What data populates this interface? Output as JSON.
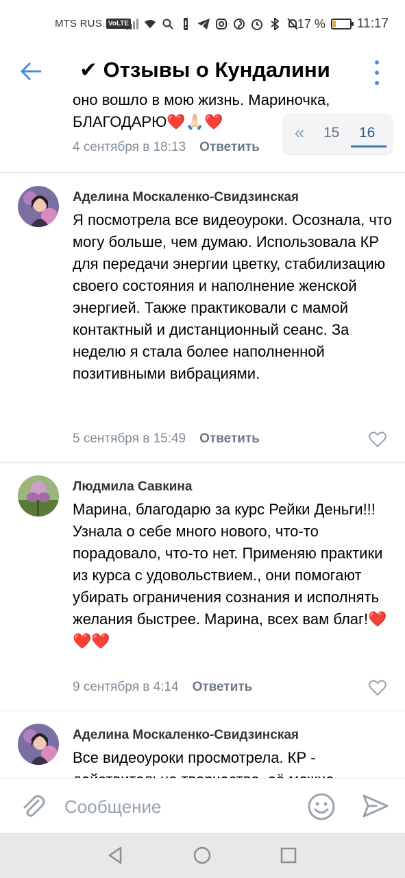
{
  "status_bar": {
    "carrier": "MTS RUS",
    "volte": "VoLTE",
    "battery_percent": "17 %",
    "battery_level": 0.17,
    "time": "11:17",
    "icons": [
      "signal-icon",
      "wifi-icon",
      "search-icon",
      "alert-icon",
      "telegram-icon",
      "instagram-icon",
      "pinterest-icon",
      "alarm-icon",
      "bluetooth-icon",
      "mute-icon"
    ]
  },
  "header": {
    "title": "✔ Отзывы о Кундалини",
    "back_icon": "arrow-left-icon",
    "more_icon": "more-vertical-icon"
  },
  "pager": {
    "prev_symbol": "«",
    "pages": [
      "15",
      "16"
    ],
    "active": "16"
  },
  "posts": [
    {
      "author": "",
      "text_lines": [
        "оно вошло в мою жизнь. Мариночка,",
        "БЛАГОДАРЮ❤️🙏🏻❤️"
      ],
      "date": "4 сентября в 18:13",
      "reply": "Ответить"
    },
    {
      "author": "Аделина Москаленко-Свидзинская",
      "text": "Я посмотрела все видеоуроки. Осознала, что могу больше, чем думаю. Использовала КР для передачи энергии цветку, стабилизацию своего состояния и наполнение женской энергией. Также практиковали с мамой контактный и дистанционный сеанс. За неделю я стала более наполненной позитивными вибрациями.",
      "date": "5 сентября в 15:49",
      "reply": "Ответить"
    },
    {
      "author": "Людмила Савкина",
      "text": "Марина, благодарю за курс Рейки Деньги!!! Узнала о себе много нового, что-то порадовало, что-то нет. Применяю практики из курса с удовольствием., они помогают убирать ограничения сознания и исполнять желания быстрее. Марина, всех вам благ!❤️❤️❤️",
      "date": "9 сентября в 4:14",
      "reply": "Ответить"
    },
    {
      "author": "Аделина Москаленко-Свидзинская",
      "text_lines": [
        "Все видеоуроки просмотрела. КР -",
        "действительно творчество, её можно"
      ]
    }
  ],
  "composer": {
    "placeholder": "Сообщение",
    "attach_icon": "paperclip-icon",
    "emoji_icon": "smile-icon",
    "send_icon": "send-icon"
  },
  "navbar": {
    "icons": [
      "nav-back-icon",
      "nav-home-icon",
      "nav-recent-icon"
    ]
  },
  "colors": {
    "accent": "#4b8cd6",
    "meta_text": "#818c99",
    "battery": "#f5a623",
    "navbar_bg": "#e8e8ea"
  }
}
